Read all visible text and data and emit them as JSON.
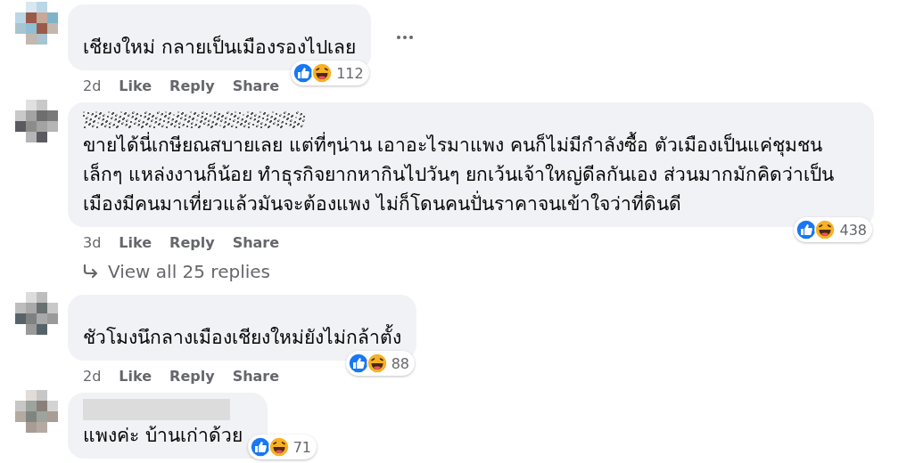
{
  "comments": [
    {
      "text": "เชียงใหม่ กลายเป็นเมืองรองไปเลย",
      "reactions": {
        "count": "112",
        "kind": "corner"
      },
      "time": "2d",
      "actions": [
        "Like",
        "Reply",
        "Share"
      ],
      "has_menu": true
    },
    {
      "name": {
        "kind": "scribble"
      },
      "text": "ขายได้นี่เกษียณสบายเลย แต่ที่ๆน่าน เอาอะไรมาแพง คนก็ไม่มีกำลังซื้อ ตัวเมืองเป็นแค่ชุมชนเล็กๆ แหล่งงานก็น้อย ทำธุรกิจยากหากินไปวันๆ ยกเว้นเจ้าใหญ่ดีลกันเอง ส่วนมากมักคิดว่าเป็นเมืองมีคนมาเที่ยวแล้วมันจะต้องแพง ไม่ก็โดนคนปั่นราคาจนเข้าใจว่าที่ดินดี",
      "reactions": {
        "count": "438",
        "kind": "corner"
      },
      "time": "3d",
      "actions": [
        "Like",
        "Reply",
        "Share"
      ],
      "has_menu": false,
      "replies_link": "View all 25 replies"
    },
    {
      "text": "ชัวโมงนึกลางเมืองเชียงใหม่ยังไม่กล้าตั้ง",
      "reactions": {
        "count": "88",
        "kind": "corner"
      },
      "time": "2d",
      "actions": [
        "Like",
        "Reply",
        "Share"
      ],
      "has_menu": false
    },
    {
      "name": {
        "kind": "bar"
      },
      "text": "แพงค่ะ บ้านเก่าด้วย",
      "reactions": {
        "count": "71",
        "kind": "trailing"
      },
      "has_menu": false
    }
  ]
}
